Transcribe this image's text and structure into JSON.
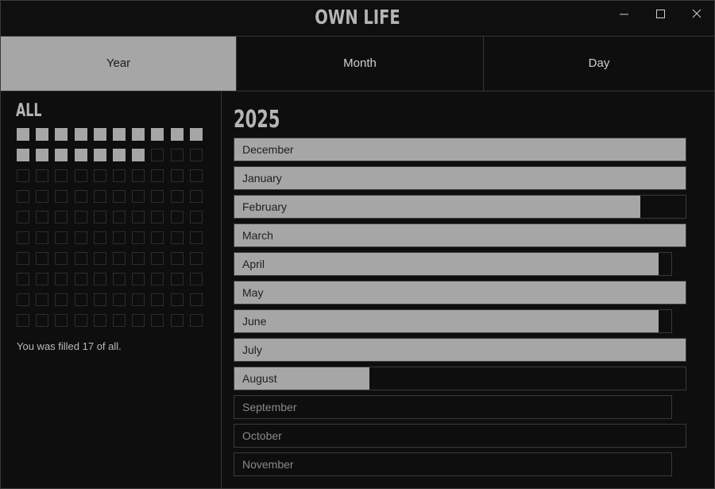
{
  "app": {
    "title": "OWN LIFE"
  },
  "tabs": [
    {
      "label": "Year",
      "active": true
    },
    {
      "label": "Month",
      "active": false
    },
    {
      "label": "Day",
      "active": false
    }
  ],
  "left": {
    "title": "ALL",
    "total_cells": 100,
    "filled_cells": 17,
    "summary": "You was filled 17 of all."
  },
  "right": {
    "year": "2025",
    "months": [
      {
        "label": "December",
        "fill": 1.0
      },
      {
        "label": "January",
        "fill": 1.0
      },
      {
        "label": "February",
        "fill": 0.9
      },
      {
        "label": "March",
        "fill": 1.0
      },
      {
        "label": "April",
        "fill": 0.97
      },
      {
        "label": "May",
        "fill": 1.0
      },
      {
        "label": "June",
        "fill": 0.97
      },
      {
        "label": "July",
        "fill": 1.0
      },
      {
        "label": "August",
        "fill": 0.3
      },
      {
        "label": "September",
        "fill": 0
      },
      {
        "label": "October",
        "fill": 0
      },
      {
        "label": "November",
        "fill": 0
      }
    ]
  },
  "colors": {
    "accent": "#a6a6a6",
    "background": "#0e0e0e",
    "border": "#353535"
  }
}
